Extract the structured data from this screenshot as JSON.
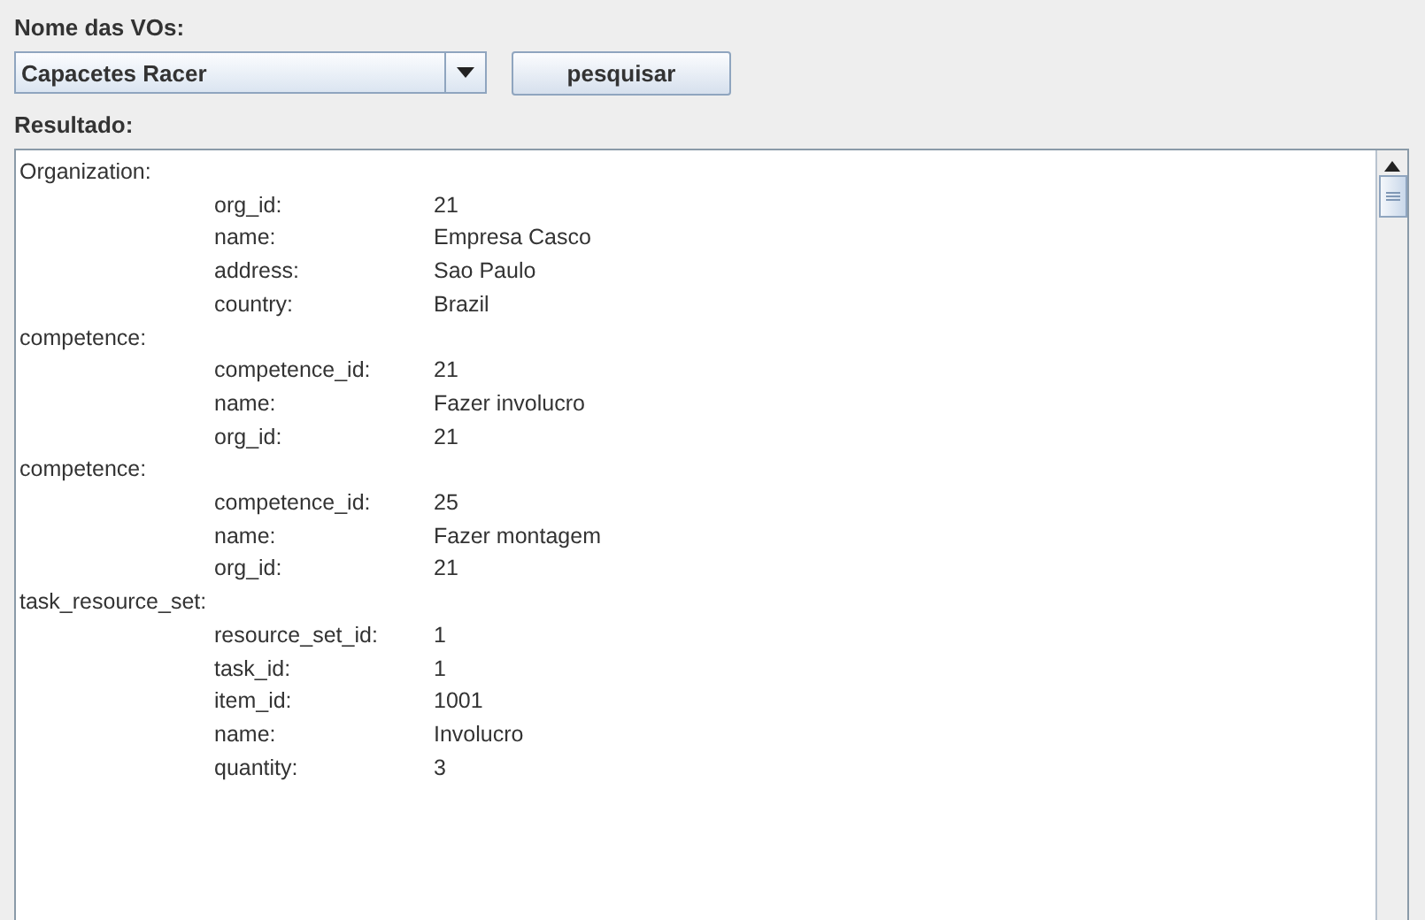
{
  "vo_label": "Nome das VOs:",
  "vo_select": {
    "value": "Capacetes Racer"
  },
  "search_button": "pesquisar",
  "result_label": "Resultado:",
  "result": [
    {
      "header": "Organization:",
      "fields": [
        {
          "key": "org_id:",
          "value": "21"
        },
        {
          "key": "name:",
          "value": "Empresa Casco"
        },
        {
          "key": "address:",
          "value": "Sao Paulo"
        },
        {
          "key": "country:",
          "value": "Brazil"
        }
      ]
    },
    {
      "header": "competence:",
      "fields": [
        {
          "key": "competence_id:",
          "value": "21"
        },
        {
          "key": "name:",
          "value": "Fazer involucro"
        },
        {
          "key": "org_id:",
          "value": "21"
        }
      ]
    },
    {
      "header": "competence:",
      "fields": [
        {
          "key": "competence_id:",
          "value": "25"
        },
        {
          "key": "name:",
          "value": "Fazer montagem"
        },
        {
          "key": "org_id:",
          "value": "21"
        }
      ]
    },
    {
      "header": "task_resource_set:",
      "fields": [
        {
          "key": "resource_set_id:",
          "value": "1"
        },
        {
          "key": "task_id:",
          "value": "1"
        },
        {
          "key": "item_id:",
          "value": "1001"
        },
        {
          "key": "name:",
          "value": "Involucro"
        },
        {
          "key": "quantity:",
          "value": "3"
        }
      ]
    }
  ]
}
